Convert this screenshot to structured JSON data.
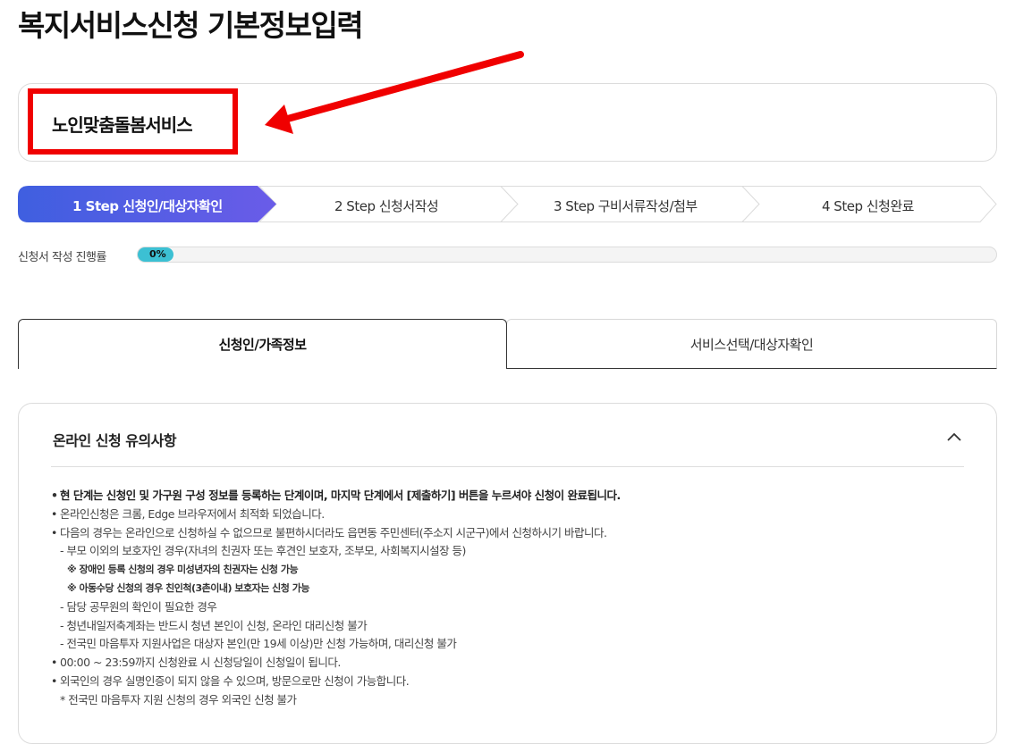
{
  "page": {
    "title": "복지서비스신청 기본정보입력"
  },
  "service": {
    "name": "노인맞춤돌봄서비스"
  },
  "steps": [
    {
      "label": "1 Step 신청인/대상자확인",
      "active": true
    },
    {
      "label": "2 Step 신청서작성",
      "active": false
    },
    {
      "label": "3 Step 구비서류작성/첨부",
      "active": false
    },
    {
      "label": "4 Step 신청완료",
      "active": false
    }
  ],
  "progress": {
    "label": "신청서 작성 진행률",
    "value": 0,
    "display": "0%"
  },
  "tabs": [
    {
      "label": "신청인/가족정보",
      "active": true
    },
    {
      "label": "서비스선택/대상자확인",
      "active": false
    }
  ],
  "notice": {
    "title": "온라인 신청 유의사항",
    "lines": [
      {
        "type": "bullet-bold",
        "text": "현 단계는 신청인 및 가구원 구성 정보를 등록하는 단계이며, 마지막 단계에서 [제출하기] 버튼을 누르셔야 신청이 완료됩니다."
      },
      {
        "type": "bullet",
        "text": "온라인신청은 크롬, Edge 브라우저에서 최적화 되었습니다."
      },
      {
        "type": "bullet",
        "text": "다음의 경우는 온라인으로 신청하실 수 없으므로 불편하시더라도 읍면동 주민센터(주소지 시군구)에서 신청하시기 바랍니다."
      },
      {
        "type": "sub",
        "text": "- 부모 이외의 보호자인 경우(자녀의 친권자 또는 후견인 보호자, 조부모, 사회복지시설장 등)"
      },
      {
        "type": "note",
        "text": "※ 장애인 등록 신청의 경우 미성년자의 친권자는 신청 가능"
      },
      {
        "type": "note",
        "text": "※ 아동수당 신청의 경우 친인척(3촌이내) 보호자는 신청 가능"
      },
      {
        "type": "sub",
        "text": "- 담당 공무원의 확인이 필요한 경우"
      },
      {
        "type": "sub",
        "text": "- 청년내일저축계좌는 반드시 청년 본인이 신청, 온라인 대리신청 불가"
      },
      {
        "type": "sub",
        "text": "- 전국민 마음투자 지원사업은 대상자 본인(만 19세 이상)만 신청 가능하며, 대리신청 불가"
      },
      {
        "type": "bullet",
        "text": "00:00 ~ 23:59까지 신청완료 시 신청당일이 신청일이 됩니다."
      },
      {
        "type": "bullet",
        "text": "외국인의 경우 실명인증이 되지 않을 수 있으며, 방문으로만 신청이 가능합니다."
      },
      {
        "type": "sub",
        "text": " * 전국민 마음투자 지원 신청의 경우 외국인 신청 불가"
      }
    ]
  },
  "colors": {
    "highlight": "#f00000",
    "step_active_start": "#3f5fe0",
    "step_active_end": "#6a5ce8",
    "progress_fill": "#3cc0d3"
  },
  "icons": {
    "collapse": "chevron-up-icon",
    "annotation": "red-arrow-icon"
  }
}
